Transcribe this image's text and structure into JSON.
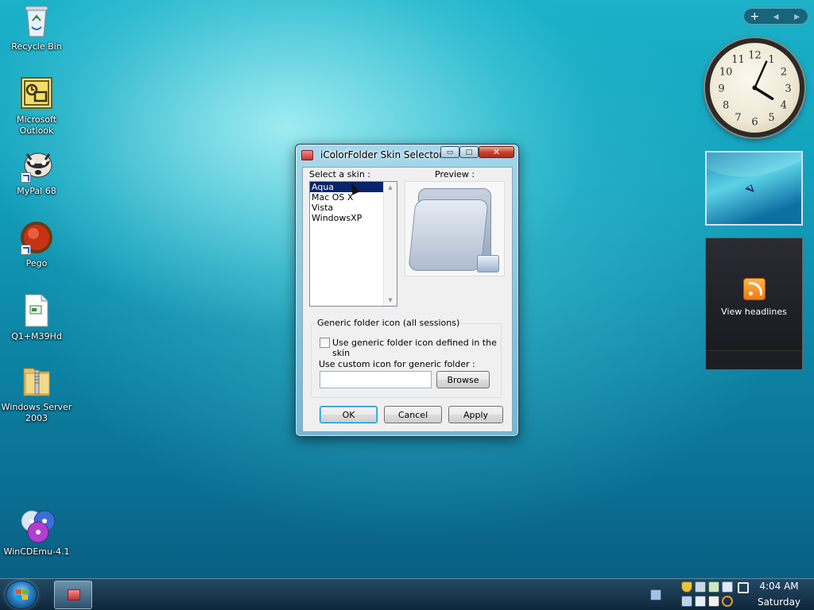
{
  "desktop": {
    "icons": [
      {
        "label_line1": "Recycle Bin",
        "label_line2": ""
      },
      {
        "label_line1": "Microsoft",
        "label_line2": "Outlook"
      },
      {
        "label_line1": "MyPal 68",
        "label_line2": ""
      },
      {
        "label_line1": "Pego",
        "label_line2": ""
      },
      {
        "label_line1": "Q1+M39Hd",
        "label_line2": ""
      },
      {
        "label_line1": "Windows Server",
        "label_line2": "2003"
      },
      {
        "label_line1": "WinCDEmu-4.1",
        "label_line2": ""
      }
    ]
  },
  "gadgets": {
    "controls": {
      "add": "+",
      "prev": "◂",
      "next": "▸"
    },
    "clock": {
      "numerals": [
        "12",
        "1",
        "2",
        "3",
        "4",
        "5",
        "6",
        "7",
        "8",
        "9",
        "10",
        "11"
      ],
      "hour_hand_angle": 122,
      "minute_hand_angle": 24
    },
    "feed": {
      "label": "View headlines"
    }
  },
  "dialog": {
    "title": "iColorFolder Skin Selector",
    "window_buttons": {
      "minimize": "▭",
      "maximize": "□",
      "close": "✕"
    },
    "select_skin_label": "Select a skin :",
    "preview_label": "Preview :",
    "skins": [
      "Aqua",
      "Mac OS X",
      "Vista",
      "WindowsXP"
    ],
    "selected_skin": "Aqua",
    "generic_group_title": "Generic folder icon (all sessions)",
    "use_generic_checkbox_label": "Use generic folder icon defined in the skin",
    "use_generic_checked": false,
    "custom_icon_label": "Use custom icon for generic folder :",
    "custom_icon_value": "",
    "browse_button": "Browse",
    "ok_button": "OK",
    "cancel_button": "Cancel",
    "apply_button": "Apply"
  },
  "taskbar": {
    "time": "4:04 AM",
    "day": "Saturday"
  },
  "colors": {
    "selection": "#0a246a",
    "accent": "#1bb1c8"
  }
}
